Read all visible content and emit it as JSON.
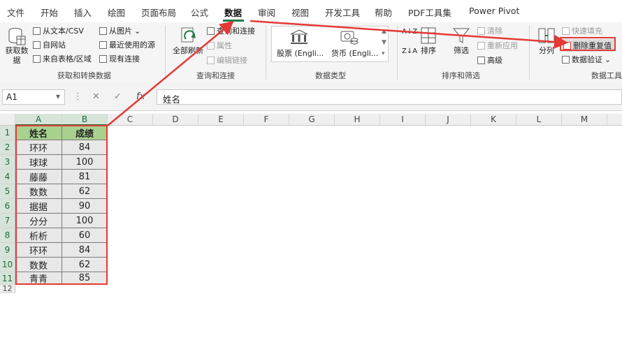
{
  "menu": {
    "tabs": [
      "文件",
      "开始",
      "插入",
      "绘图",
      "页面布局",
      "公式",
      "数据",
      "审阅",
      "视图",
      "开发工具",
      "帮助",
      "PDF工具集",
      "Power Pivot"
    ],
    "active": "数据"
  },
  "ribbon": {
    "get_data": {
      "big_label_1": "获取数",
      "big_label_2": "据",
      "from_text_csv": "从文本/CSV",
      "from_web": "自网站",
      "from_table": "来自表格/区域",
      "from_picture": "从图片",
      "recent_sources": "最近使用的源",
      "existing_connections": "现有连接",
      "group_label": "获取和转换数据"
    },
    "queries": {
      "refresh_label": "全部刷新",
      "queries_connections": "查询和连接",
      "properties": "属性",
      "edit_links": "编辑链接",
      "group_label": "查询和连接"
    },
    "data_types": {
      "stocks": "股票 (Engli...",
      "currencies": "货币 (Engli...",
      "group_label": "数据类型"
    },
    "sort_filter": {
      "sort_az": "A↓Z",
      "sort_za": "Z↓A",
      "sort": "排序",
      "filter": "筛选",
      "clear": "清除",
      "reapply": "重新应用",
      "advanced": "高级",
      "group_label": "排序和筛选"
    },
    "data_tools": {
      "text_to_columns": "分列",
      "flash_fill": "快速填充",
      "remove_duplicates": "删除重复值",
      "data_validation": "数据验证",
      "group_label": "数据工具"
    }
  },
  "formula_bar": {
    "name_box": "A1",
    "cancel": "✕",
    "enter": "✓",
    "fx": "fx",
    "content": "姓名"
  },
  "columns": [
    "A",
    "B",
    "C",
    "D",
    "E",
    "F",
    "G",
    "H",
    "I",
    "J",
    "K",
    "L",
    "M"
  ],
  "rows": [
    "1",
    "2",
    "3",
    "4",
    "5",
    "6",
    "7",
    "8",
    "9",
    "10",
    "11",
    "12"
  ],
  "table": {
    "headers": [
      "姓名",
      "成绩"
    ],
    "rows": [
      [
        "环环",
        "84"
      ],
      [
        "球球",
        "100"
      ],
      [
        "藤藤",
        "81"
      ],
      [
        "数数",
        "62"
      ],
      [
        "据据",
        "90"
      ],
      [
        "分分",
        "100"
      ],
      [
        "析析",
        "60"
      ],
      [
        "环环",
        "84"
      ],
      [
        "数数",
        "62"
      ],
      [
        "青青",
        "85"
      ]
    ]
  },
  "colors": {
    "accent": "#1e7b45",
    "header_fill": "#a9d18e",
    "data_fill": "#e8e8e8",
    "annotation": "#e53935"
  }
}
